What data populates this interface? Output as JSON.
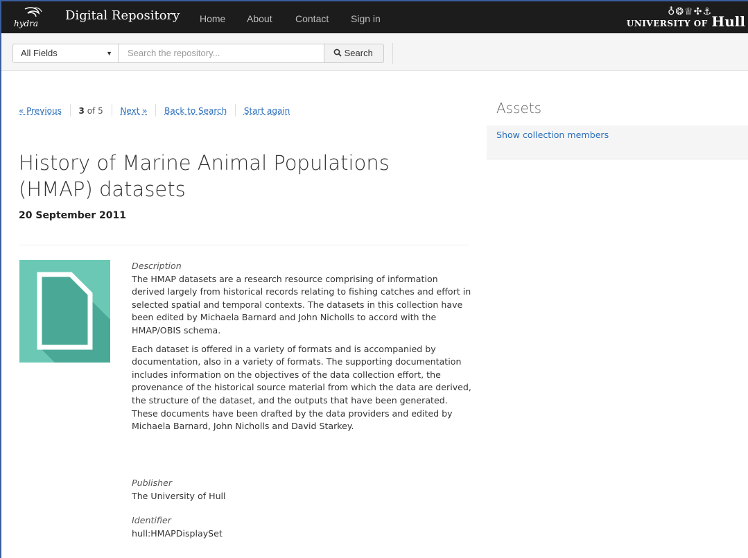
{
  "navbar": {
    "logo_text": "hydra",
    "brand": "Digital Repository",
    "links": [
      "Home",
      "About",
      "Contact",
      "Sign in"
    ],
    "university_small": "UNIVERSITY OF",
    "university_big": "Hull"
  },
  "search": {
    "field_select": "All Fields",
    "placeholder": "Search the repository...",
    "button_label": "Search"
  },
  "pager": {
    "previous": "« Previous",
    "current": "3",
    "of_total": " of 5",
    "next": "Next »",
    "back": "Back to Search",
    "start_again": "Start again"
  },
  "record": {
    "title": "History of Marine Animal Populations (HMAP) datasets",
    "date": "20 September 2011",
    "description_label": "Description",
    "description_p1": "The HMAP datasets are a research resource comprising of information derived largely from historical records relating to fishing catches and effort in selected spatial and temporal contexts. The datasets in this collection have been edited by Michaela Barnard and John Nicholls to accord with the HMAP/OBIS schema.",
    "description_p2": "Each dataset is offered in a variety of formats and is accompanied by documentation, also in a variety of formats. The supporting documentation includes information on the objectives of the data collection effort, the provenance of the historical source material from which the data are derived, the structure of the dataset, and the outputs that have been generated. These documents have been drafted by the data providers and edited by Michaela Barnard, John Nicholls and David Starkey.",
    "publisher_label": "Publisher",
    "publisher": "The University of Hull",
    "identifier_label": "Identifier",
    "identifier": "hull:HMAPDisplaySet"
  },
  "assets": {
    "heading": "Assets",
    "link": "Show collection members"
  },
  "colors": {
    "navbar_bg": "#1c1c1c",
    "link": "#2a6ebb",
    "thumb_bg": "#6ac8b5",
    "thumb_shadow": "#4aa896"
  }
}
